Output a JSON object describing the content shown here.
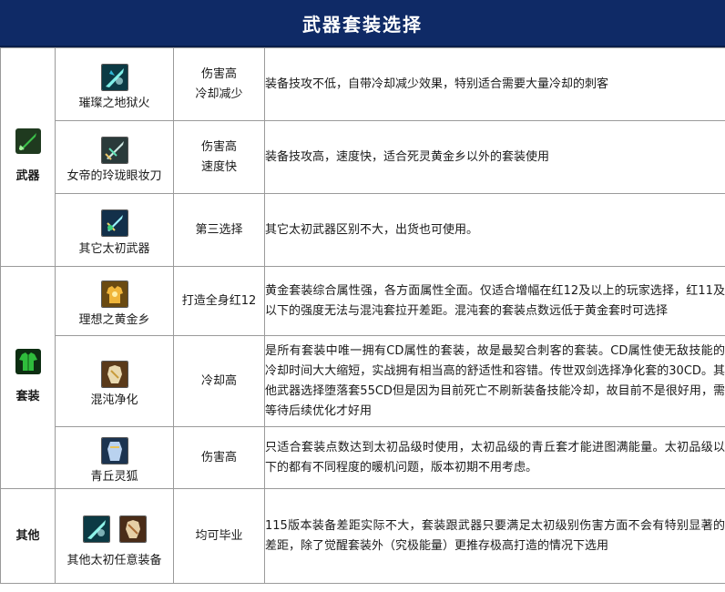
{
  "title": "武器套装选择",
  "categories": {
    "weapon": "武器",
    "set": "套装",
    "other": "其他"
  },
  "rows": [
    {
      "name": "璀璨之地狱火",
      "tag": [
        "伤害高",
        "冷却减少"
      ],
      "desc": "装备技攻不低，自带冷却减少效果，特别适合需要大量冷却的刺客"
    },
    {
      "name": "女帝的玲珑眼妆刀",
      "tag": [
        "伤害高",
        "速度快"
      ],
      "desc": "装备技攻高，速度快，适合死灵黄金乡以外的套装使用"
    },
    {
      "name": "其它太初武器",
      "tag": [
        "第三选择"
      ],
      "desc": "其它太初武器区别不大，出货也可使用。"
    },
    {
      "name": "理想之黄金乡",
      "tag": [
        "打造全身红12"
      ],
      "desc": "黄金套装综合属性强，各方面属性全面。仅适合增幅在红12及以上的玩家选择，红11及以下的强度无法与混沌套拉开差距。混沌套的套装点数远低于黄金套时可选择"
    },
    {
      "name": "混沌净化",
      "tag": [
        "冷却高"
      ],
      "desc": "是所有套装中唯一拥有CD属性的套装，故是最契合刺客的套装。CD属性使无敌技能的冷却时间大大缩短，实战拥有相当高的舒适性和容错。传世双剑选择净化套的30CD。其他武器选择堕落套55CD但是因为目前死亡不刷新装备技能冷却，故目前不是很好用，需等待后续优化才好用"
    },
    {
      "name": "青丘灵狐",
      "tag": [
        "伤害高"
      ],
      "desc": "只适合套装点数达到太初品级时使用，太初品级的青丘套才能进图满能量。太初品级以下的都有不同程度的暖机问题，版本初期不用考虑。"
    },
    {
      "name": "其他太初任意装备",
      "tag": [
        "均可毕业"
      ],
      "desc": "115版本装备差距实际不大，套装跟武器只要满足太初级别伤害方面不会有特别显著的差距，除了觉醒套装外（究极能量）更推存极高打造的情况下选用"
    }
  ],
  "colors": {
    "title_bg": "#0f2a66",
    "title_text": "#ffffff",
    "border": "#9a9a9a"
  },
  "icons": {
    "weapon_category": "green-sword-icon",
    "set_category": "green-armor-icon",
    "row0": "hellfire-sword-icon",
    "row1": "empress-blade-icon",
    "row2": "primordial-weapon-icon",
    "row3": "golden-armor-icon",
    "row4": "chaos-purify-icon",
    "row5": "fox-robe-icon",
    "row6a": "primordial-sword-icon",
    "row6b": "primordial-armor-icon"
  }
}
